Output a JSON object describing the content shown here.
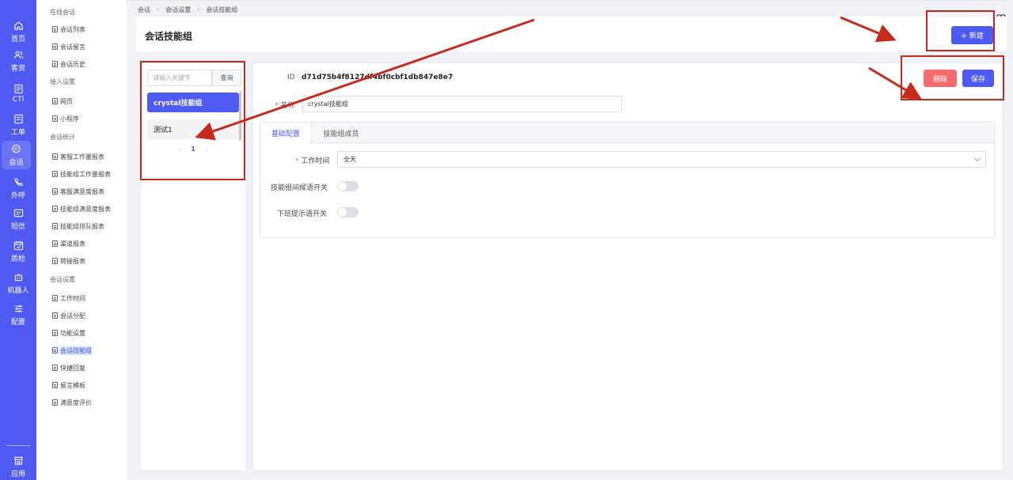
{
  "rail": {
    "items": [
      {
        "label": "首页",
        "icon": "home-icon"
      },
      {
        "label": "客资",
        "icon": "users-icon"
      },
      {
        "label": "CTI",
        "icon": "cti-icon"
      },
      {
        "label": "工单",
        "icon": "ticket-icon"
      },
      {
        "label": "会话",
        "icon": "chat-icon"
      },
      {
        "label": "外呼",
        "icon": "phone-icon"
      },
      {
        "label": "短信",
        "icon": "sms-icon"
      },
      {
        "label": "质检",
        "icon": "calendar-check-icon"
      },
      {
        "label": "机器人",
        "icon": "robot-icon"
      },
      {
        "label": "配置",
        "icon": "sliders-icon"
      }
    ],
    "apps_label": "应用",
    "active": "会话"
  },
  "submenu": {
    "sections": [
      {
        "title": "在线会话",
        "items": [
          "会话列表",
          "会话留言",
          "会话历史"
        ]
      },
      {
        "title": "接入设置",
        "items": [
          "网页",
          "小程序"
        ]
      },
      {
        "title": "会话统计",
        "items": [
          "客服工作量报表",
          "技能组工作量报表",
          "客服满意度报表",
          "技能组满意度报表",
          "技能组排队报表",
          "渠道报表",
          "转接报表"
        ]
      },
      {
        "title": "会话设置",
        "items": [
          "工作时间",
          "会话分配",
          "功能设置",
          "会话技能组",
          "快捷回复",
          "留言模板",
          "满意度评价"
        ]
      }
    ],
    "active_item": "会话技能组"
  },
  "breadcrumb": [
    "会话",
    "会话设置",
    "会话技能组"
  ],
  "header": {
    "title": "会话技能组",
    "new_button": "+ 新建"
  },
  "corner_icon": "book-icon",
  "list": {
    "search_placeholder": "请输入关键字",
    "search_button": "查询",
    "groups": [
      "crystal技能组",
      "测试1"
    ],
    "selected": "crystal技能组",
    "pager": {
      "prev": "‹",
      "page": "1",
      "next": "›"
    }
  },
  "detail": {
    "id_label": "ID",
    "id_value": "d71d75b4f8127df4bf0cbf1db847e8e7",
    "delete_button": "删除",
    "save_button": "保存",
    "name_label": "名称",
    "name_value": "crystal技能组",
    "tabs": [
      "基础配置",
      "技能组成员"
    ],
    "active_tab": "基础配置",
    "form": {
      "work_time_label": "工作时间",
      "work_time_value": "全天",
      "queue_greeting_label": "技能组间候语开关",
      "queue_greeting_on": false,
      "offwork_tip_label": "下班提示语开关",
      "offwork_tip_on": false
    }
  },
  "colors": {
    "brand": "#4e5bf2",
    "danger": "#f56c6c",
    "annotation": "#c62a1c"
  }
}
